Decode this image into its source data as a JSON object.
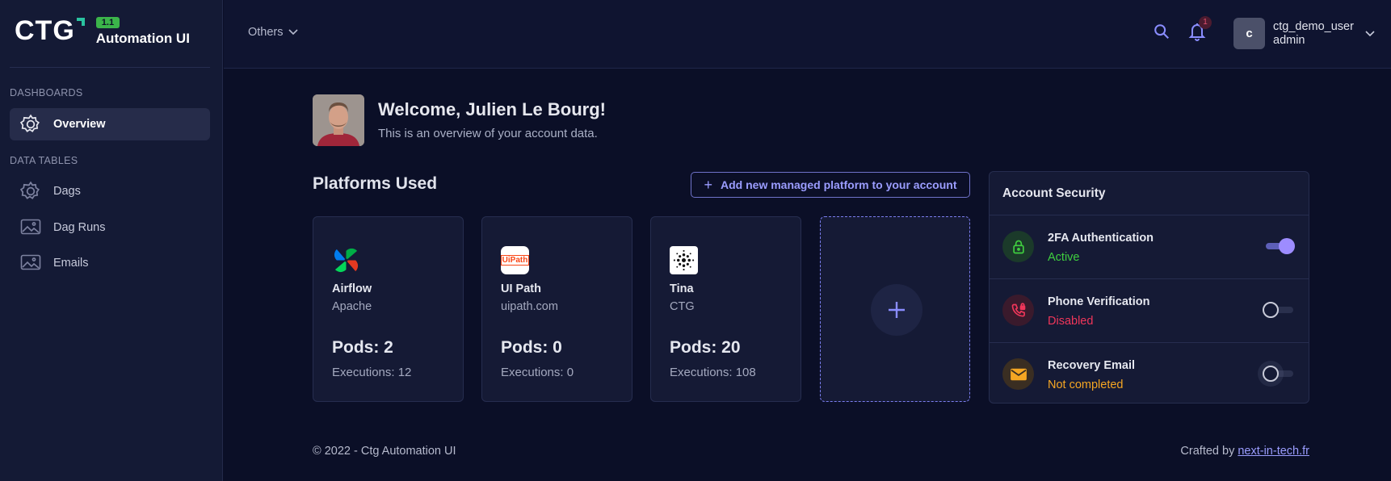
{
  "brand": {
    "logo_text": "CTG",
    "version": "1.1",
    "name": "Automation UI"
  },
  "sidebar": {
    "sections": [
      {
        "label": "DASHBOARDS"
      },
      {
        "label": "DATA TABLES"
      }
    ],
    "items": [
      {
        "label": "Overview",
        "icon": "gear-icon",
        "active": true
      },
      {
        "label": "Dags",
        "icon": "gear-icon"
      },
      {
        "label": "Dag Runs",
        "icon": "image-icon"
      },
      {
        "label": "Emails",
        "icon": "image-icon"
      }
    ]
  },
  "header": {
    "menu_label": "Others",
    "notifications_count": "1",
    "user": {
      "initial": "c",
      "name": "ctg_demo_user",
      "role": "admin"
    }
  },
  "welcome": {
    "title": "Welcome, Julien Le Bourg!",
    "subtitle": "This is an overview of your account data."
  },
  "platforms": {
    "title": "Platforms Used",
    "add_button": "Add new managed platform to your account",
    "cards": [
      {
        "name": "Airflow",
        "vendor": "Apache",
        "pods": "Pods: 2",
        "executions": "Executions: 12",
        "logo": "airflow-logo"
      },
      {
        "name": "UI Path",
        "vendor": "uipath.com",
        "pods": "Pods: 0",
        "executions": "Executions: 0",
        "logo": "uipath-logo",
        "logo_text": "UiPath"
      },
      {
        "name": "Tina",
        "vendor": "CTG",
        "pods": "Pods: 20",
        "executions": "Executions: 108",
        "logo": "tina-logo"
      }
    ]
  },
  "security": {
    "title": "Account Security",
    "items": [
      {
        "name": "2FA Authentication",
        "status": "Active",
        "status_color": "#3fcf3f",
        "enabled": true,
        "icon": "lock-icon"
      },
      {
        "name": "Phone Verification",
        "status": "Disabled",
        "status_color": "#f0365a",
        "enabled": false,
        "icon": "phone-lock-icon"
      },
      {
        "name": "Recovery Email",
        "status": "Not completed",
        "status_color": "#f5a623",
        "enabled": false,
        "icon": "mail-icon"
      }
    ]
  },
  "footer": {
    "copyright": "© 2022 - Ctg Automation UI",
    "crafted_prefix": "Crafted by ",
    "crafted_link": "next-in-tech.fr"
  },
  "colors": {
    "accent": "#8a8dff",
    "background": "#0b0f27",
    "panel": "#151a35"
  }
}
